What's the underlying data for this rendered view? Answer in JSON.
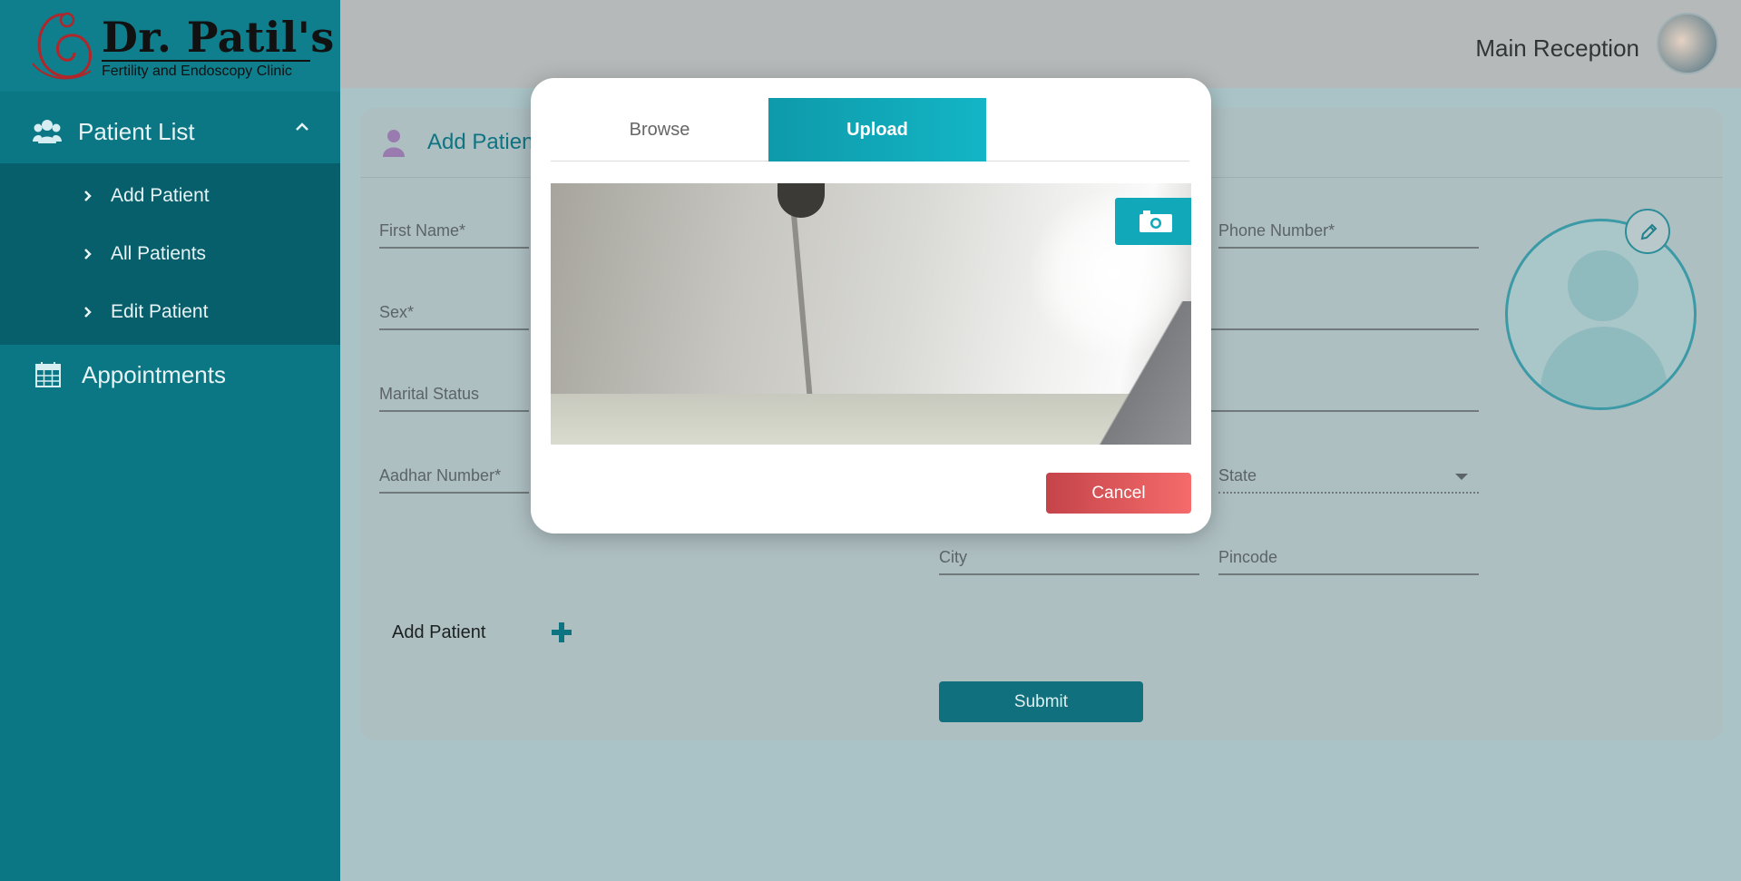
{
  "logo": {
    "title": "Dr. Patil's",
    "subtitle": "Fertility and Endoscopy Clinic"
  },
  "sidebar": {
    "group": {
      "label": "Patient List",
      "icon": "users-icon"
    },
    "items": [
      {
        "label": "Add Patient"
      },
      {
        "label": "All Patients"
      },
      {
        "label": "Edit Patient"
      }
    ],
    "appointments": {
      "label": "Appointments",
      "icon": "calendar-icon"
    }
  },
  "header": {
    "user": "Main Reception"
  },
  "form": {
    "title": "Add Patient",
    "fields": {
      "first_name": "First Name*",
      "phone": "Phone Number*",
      "sex": "Sex*",
      "marital": "Marital Status",
      "aadhar": "Aadhar Number*",
      "state": "State",
      "city": "City",
      "pincode": "Pincode"
    },
    "add_patient_label": "Add Patient",
    "submit_label": "Submit"
  },
  "modal": {
    "tabs": [
      {
        "label": "Browse"
      },
      {
        "label": "Upload",
        "active": true
      }
    ],
    "cancel_label": "Cancel"
  },
  "colors": {
    "sidebar": "#0b7785",
    "accent": "#13b5c6",
    "cancel": "#e05a5e"
  }
}
